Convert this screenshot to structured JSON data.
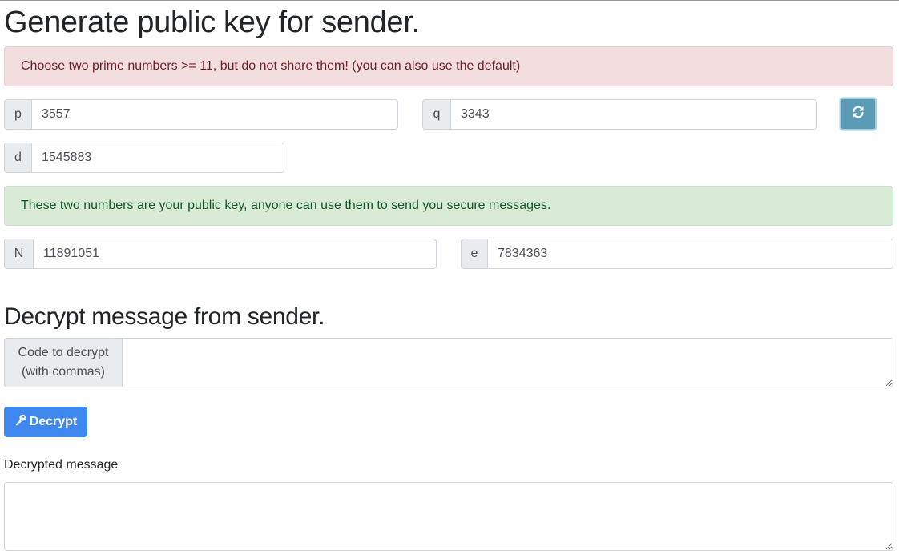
{
  "generate": {
    "title": "Generate public key for sender.",
    "alert": "Choose two prime numbers >= 11, but do not share them! (you can also use the default)",
    "p": {
      "label": "p",
      "value": "3557"
    },
    "q": {
      "label": "q",
      "value": "3343"
    },
    "d": {
      "label": "d",
      "value": "1545883"
    },
    "refresh_icon": "refresh-icon",
    "public_key_alert": "These two numbers are your public key, anyone can use them to send you secure messages.",
    "N": {
      "label": "N",
      "value": "11891051"
    },
    "e": {
      "label": "e",
      "value": "7834363"
    }
  },
  "decrypt": {
    "title": "Decrypt message from sender.",
    "code_label": "Code to decrypt\n(with commas)",
    "code_value": "",
    "button_label": "Decrypt",
    "button_icon": "key-icon",
    "result_label": "Decrypted message",
    "result_value": ""
  },
  "colors": {
    "danger_bg": "#f2dede",
    "success_bg": "#d9ebd6",
    "primary": "#3f88f0",
    "info": "#5b9bb5"
  }
}
